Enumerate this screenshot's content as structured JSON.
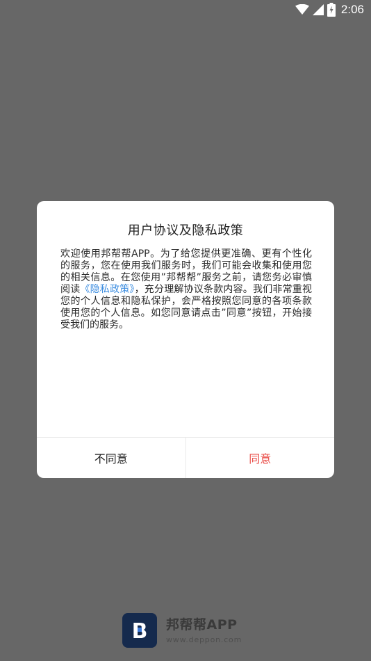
{
  "status_bar": {
    "time": "2:06",
    "icons": [
      "wifi-icon",
      "cellular-signal-icon",
      "battery-charging-icon"
    ]
  },
  "dialog": {
    "title": "用户协议及隐私政策",
    "body_before_link": "欢迎使用邦帮帮APP。为了给您提供更准确、更有个性化的服务，您在使用我们服务时，我们可能会收集和使用您的相关信息。在您使用”邦帮帮”服务之前，请您务必审慎阅读",
    "policy_link": "《隐私政策》",
    "body_after_link": "，充分理解协议条款内容。我们非常重视您的个人信息和隐私保护，会严格按照您同意的各项条款使用您的个人信息。如您同意请点击”同意”按钮，开始接受我们的服务。",
    "disagree_label": "不同意",
    "agree_label": "同意"
  },
  "brand": {
    "name": "邦帮帮APP",
    "url": "www.deppon.com",
    "logo_letter": "B",
    "logo_color": "#152a4d"
  },
  "colors": {
    "overlay": "#676767",
    "link": "#3c8de0",
    "agree": "#e94c47"
  }
}
